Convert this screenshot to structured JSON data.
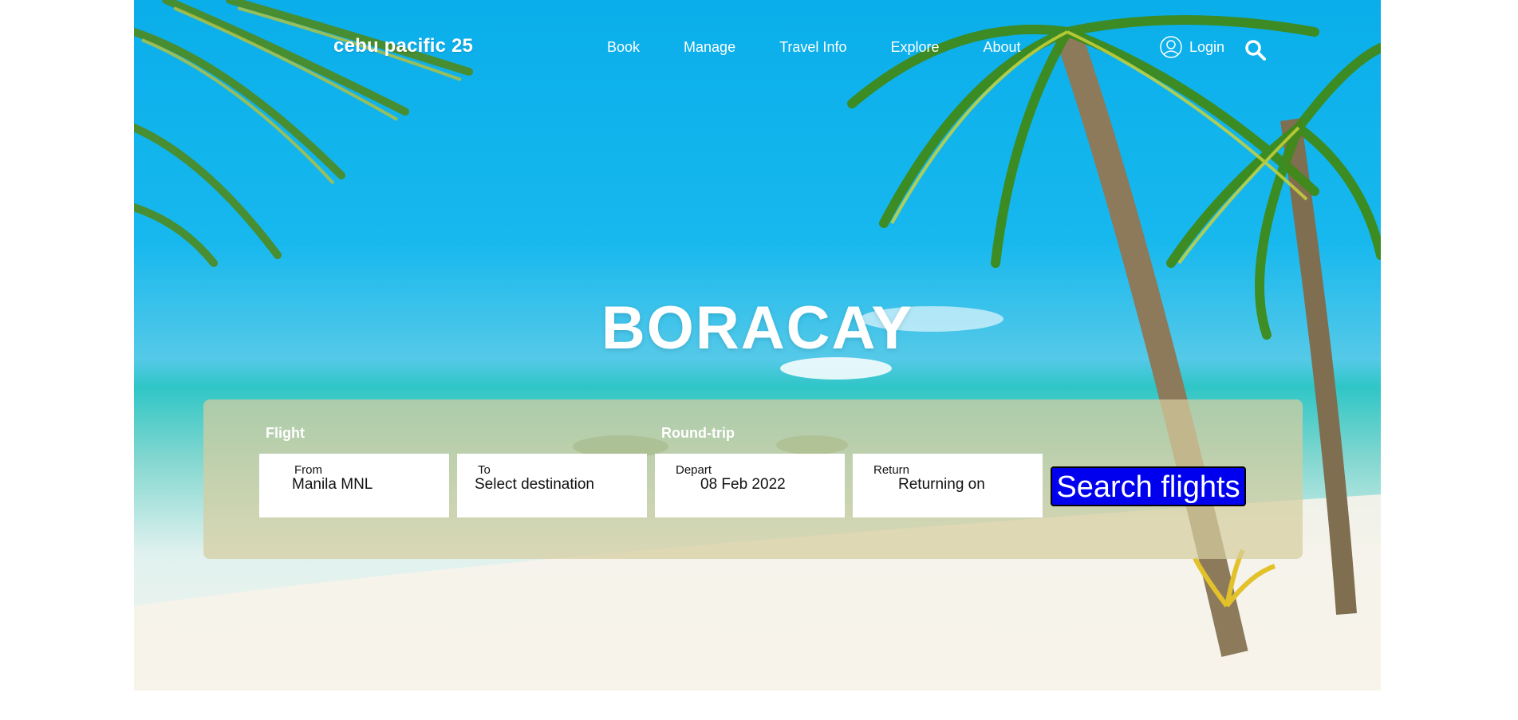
{
  "header": {
    "brand": "cebu pacific 25",
    "nav": [
      "Book",
      "Manage",
      "Travel Info",
      "Explore",
      "About"
    ],
    "login_label": "Login",
    "icons": {
      "login": "user-circle-icon",
      "search": "search-icon"
    }
  },
  "hero": {
    "title": "BORACAY"
  },
  "booking": {
    "flight_label": "Flight",
    "trip_label": "Round-trip",
    "from": {
      "label": "From",
      "value": "Manila MNL"
    },
    "to": {
      "label": "To",
      "value": "Select destination"
    },
    "depart": {
      "label": "Depart",
      "value": "08 Feb 2022"
    },
    "return": {
      "label": "Return",
      "value": "Returning on"
    },
    "search_button": "Search flights"
  },
  "colors": {
    "button_bg": "#0000ee",
    "panel_bg": "rgba(214,205,160,0.72)",
    "text_light": "#ffffff"
  }
}
